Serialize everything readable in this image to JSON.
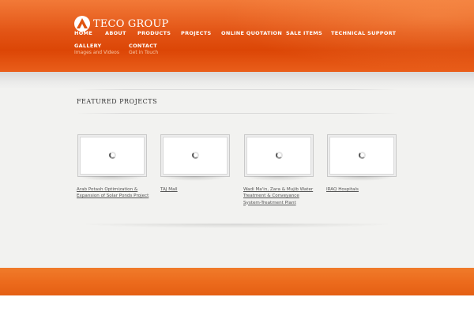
{
  "brand": {
    "name": "TECO GROUP",
    "logo_icon": "teco-logo-icon"
  },
  "nav": [
    {
      "label": "HOME"
    },
    {
      "label": "ABOUT"
    },
    {
      "label": "PRODUCTS"
    },
    {
      "label": "PROJECTS"
    },
    {
      "label": "ONLINE QUOTATION"
    },
    {
      "label": "SALE ITEMS"
    },
    {
      "label": "TECHNICAL SUPPORT"
    },
    {
      "label": "GALLERY",
      "sub": "Images and Videos"
    },
    {
      "label": "CONTACT",
      "sub": "Get in Touch"
    }
  ],
  "featured": {
    "title": "FEATURED PROJECTS",
    "projects": [
      {
        "caption": "Arab Potash Optimization & Expansion of Solar Ponds Project",
        "icon": "loading-spinner-icon"
      },
      {
        "caption": "TAJ Mall",
        "icon": "loading-spinner-icon"
      },
      {
        "caption": "Wadi Ma'in, Zara & Mujib Water Treatment & Conveyance System-Treatment Plant",
        "icon": "loading-spinner-icon"
      },
      {
        "caption": "IRAQ Hospitals",
        "icon": "loading-spinner-icon"
      }
    ]
  },
  "colors": {
    "header_orange": "#e14c0a",
    "footer_orange": "#ec6a1c",
    "content_bg": "#f2f2f0"
  }
}
